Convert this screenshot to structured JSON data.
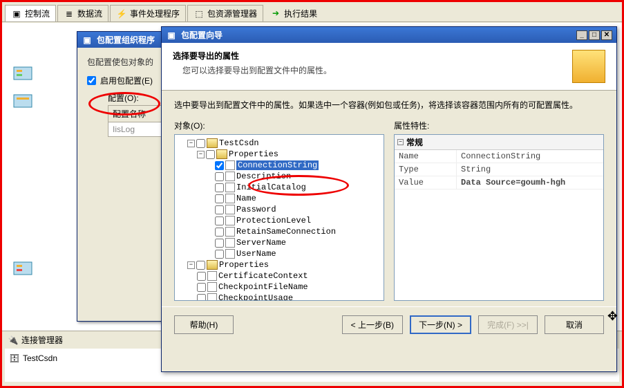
{
  "tabs": {
    "control": "控制流",
    "data": "数据流",
    "event": "事件处理程序",
    "package": "包资源管理器",
    "result": "执行结果"
  },
  "conn_mgr": {
    "title": "连接管理器",
    "item": "TestCsdn"
  },
  "organizer": {
    "title": "包配置组织程序",
    "desc": "包配置使包对象的",
    "enable": "启用包配置(E)",
    "configs_label": "配置(O):",
    "col_name": "配置名称",
    "row1": "IisLog"
  },
  "wizard": {
    "title": "包配置向导",
    "header_title": "选择要导出的属性",
    "header_sub": "您可以选择要导出到配置文件中的属性。",
    "instruction": "选中要导出到配置文件中的属性。如果选中一个容器(例如包或任务)，将选择该容器范围内所有的可配置属性。",
    "objects_label": "对象(O):",
    "props_label": "属性特性:",
    "tree": {
      "root": "TestCsdn",
      "group1": "Properties",
      "items": [
        "ConnectionString",
        "Description",
        "InitialCatalog",
        "Name",
        "Password",
        "ProtectionLevel",
        "RetainSameConnection",
        "ServerName",
        "UserName"
      ],
      "group2": "Properties",
      "items2": [
        "CertificateContext",
        "CheckpointFileName",
        "CheckpointUsage"
      ]
    },
    "prop_general": "常规",
    "prop_rows": [
      {
        "k": "Name",
        "v": "ConnectionString"
      },
      {
        "k": "Type",
        "v": "String"
      },
      {
        "k": "Value",
        "v": "Data Source=goumh-hgh"
      }
    ],
    "buttons": {
      "help": "帮助(H)",
      "back": "< 上一步(B)",
      "next": "下一步(N) >",
      "finish": "完成(F) >>|",
      "cancel": "取消"
    }
  }
}
